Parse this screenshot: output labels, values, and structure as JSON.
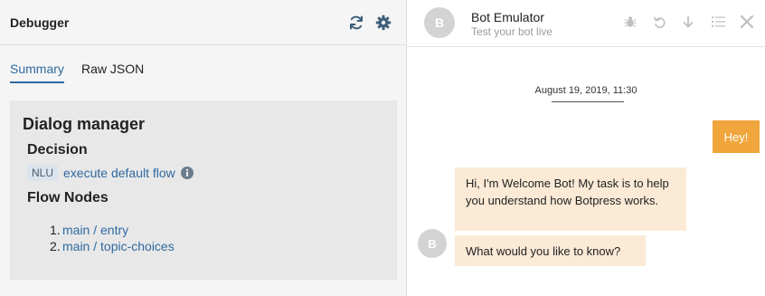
{
  "debugger": {
    "title": "Debugger",
    "tabs": [
      {
        "label": "Summary",
        "active": true
      },
      {
        "label": "Raw JSON",
        "active": false
      }
    ],
    "section_title": "Dialog manager",
    "decision_heading": "Decision",
    "decision_badge": "NLU",
    "decision_text": "execute default flow",
    "flow_nodes_heading": "Flow Nodes",
    "flow_nodes": [
      {
        "num": "1.",
        "label": "main / entry"
      },
      {
        "num": "2.",
        "label": "main / topic-choices"
      }
    ],
    "icons": [
      "refresh-icon",
      "gear-icon",
      "info-icon"
    ]
  },
  "emulator": {
    "avatar_letter": "B",
    "title": "Bot Emulator",
    "subtitle": "Test your bot live",
    "icons": [
      "bug-icon",
      "undo-icon",
      "download-icon",
      "list-icon",
      "close-icon"
    ],
    "date": "August 19, 2019, 11:30",
    "messages": [
      {
        "from": "user",
        "text": "Hey!"
      },
      {
        "from": "bot",
        "text": "Hi, I'm Welcome Bot! My task is to help you understand how Botpress works."
      },
      {
        "from": "bot",
        "text": "What would you like to know?"
      }
    ]
  },
  "colors": {
    "link": "#2f6aa0",
    "user_bubble": "#f0a63c",
    "bot_bubble": "#fbead6",
    "panel_bg": "#f5f5f5",
    "card_bg": "#e8e8e8"
  }
}
